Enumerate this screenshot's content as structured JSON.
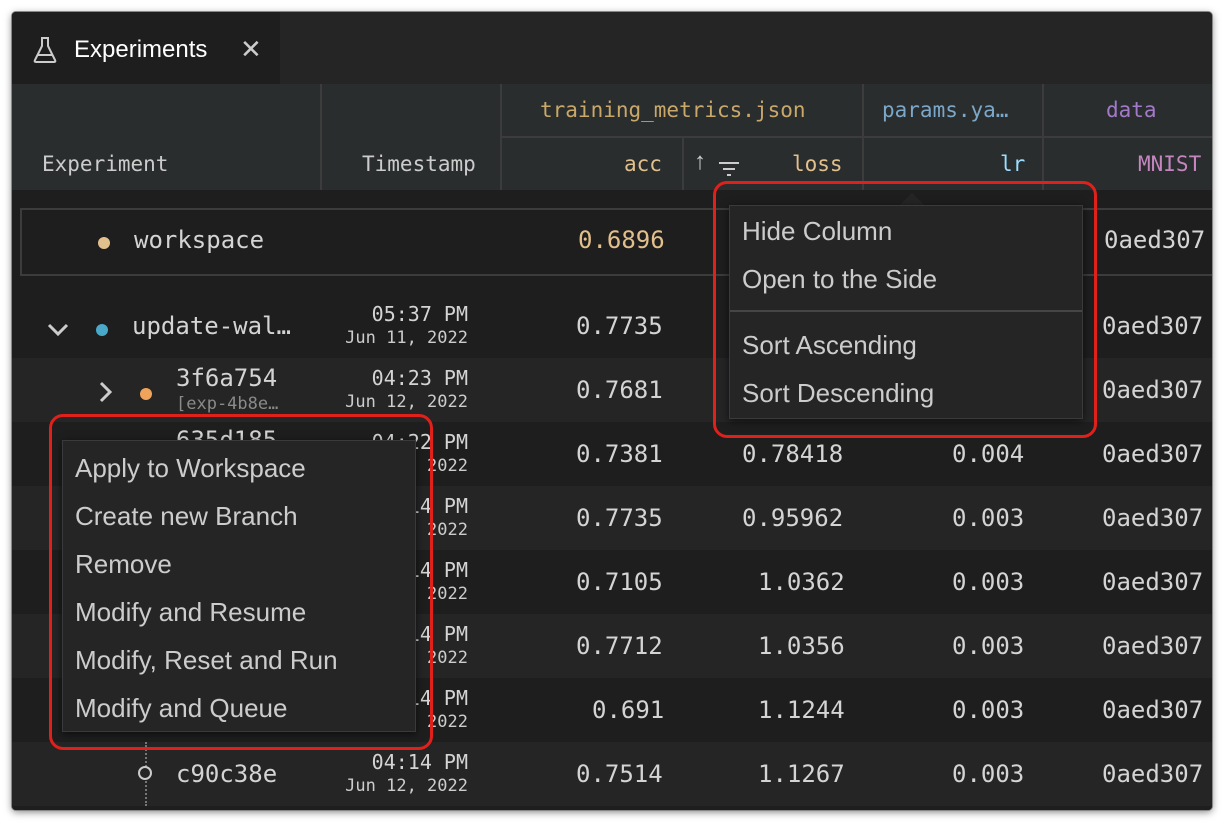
{
  "tab": {
    "title": "Experiments",
    "close": "✕",
    "icon": "flask-icon"
  },
  "header": {
    "groups": {
      "training": "training_metrics.json",
      "params": "params.ya…",
      "data": "data"
    },
    "columns": {
      "experiment": "Experiment",
      "timestamp": "Timestamp",
      "acc": "acc",
      "loss": "loss",
      "lr": "lr",
      "mnist": "MNIST"
    },
    "sort_icon": "↑"
  },
  "workspace": {
    "name": "workspace",
    "acc": "0.6896",
    "data": "0aed307"
  },
  "rows": [
    {
      "name": "update-wal…",
      "time": "05:37 PM",
      "date": "Jun 11, 2022",
      "acc": "0.7735",
      "loss": "",
      "lr": "",
      "data": "0aed307"
    },
    {
      "name": "3f6a754",
      "sub": "[exp-4b8e…",
      "time": "04:23 PM",
      "date": "Jun 12, 2022",
      "acc": "0.7681",
      "loss": "",
      "lr": "",
      "data": "0aed307"
    },
    {
      "name": "635d185",
      "time": "04:22 PM",
      "date": "Jun 12, 2022",
      "acc": "0.7381",
      "loss": "0.78418",
      "lr": "0.004",
      "data": "0aed307"
    },
    {
      "name": "",
      "time": "04:14 PM",
      "date": "Jun 12, 2022",
      "acc": "0.7735",
      "loss": "0.95962",
      "lr": "0.003",
      "data": "0aed307"
    },
    {
      "name": "",
      "time": "04:14 PM",
      "date": "Jun 12, 2022",
      "acc": "0.7105",
      "loss": "1.0362",
      "lr": "0.003",
      "data": "0aed307"
    },
    {
      "name": "",
      "time": "04:14 PM",
      "date": "Jun 12, 2022",
      "acc": "0.7712",
      "loss": "1.0356",
      "lr": "0.003",
      "data": "0aed307"
    },
    {
      "name": "",
      "time": "04:14 PM",
      "date": "Jun 12, 2022",
      "acc": "0.691",
      "loss": "1.1244",
      "lr": "0.003",
      "data": "0aed307"
    },
    {
      "name": "c90c38e",
      "time": "04:14 PM",
      "date": "Jun 12, 2022",
      "acc": "0.7514",
      "loss": "1.1267",
      "lr": "0.003",
      "data": "0aed307"
    }
  ],
  "column_menu": {
    "hide": "Hide Column",
    "open_side": "Open to the Side",
    "sort_asc": "Sort Ascending",
    "sort_desc": "Sort Descending"
  },
  "row_menu": {
    "apply": "Apply to Workspace",
    "branch": "Create new Branch",
    "remove": "Remove",
    "resume": "Modify and Resume",
    "reset_run": "Modify, Reset and Run",
    "queue": "Modify and Queue"
  },
  "colors": {
    "accent_red": "#e0201b",
    "workspace_dot": "#e2c08d",
    "blue_dot": "#3794ff",
    "orange_dot": "#f0a35a",
    "metrics_header": "#c9a86a",
    "params_header": "#7ca7c9",
    "data_header": "#a379c9"
  }
}
